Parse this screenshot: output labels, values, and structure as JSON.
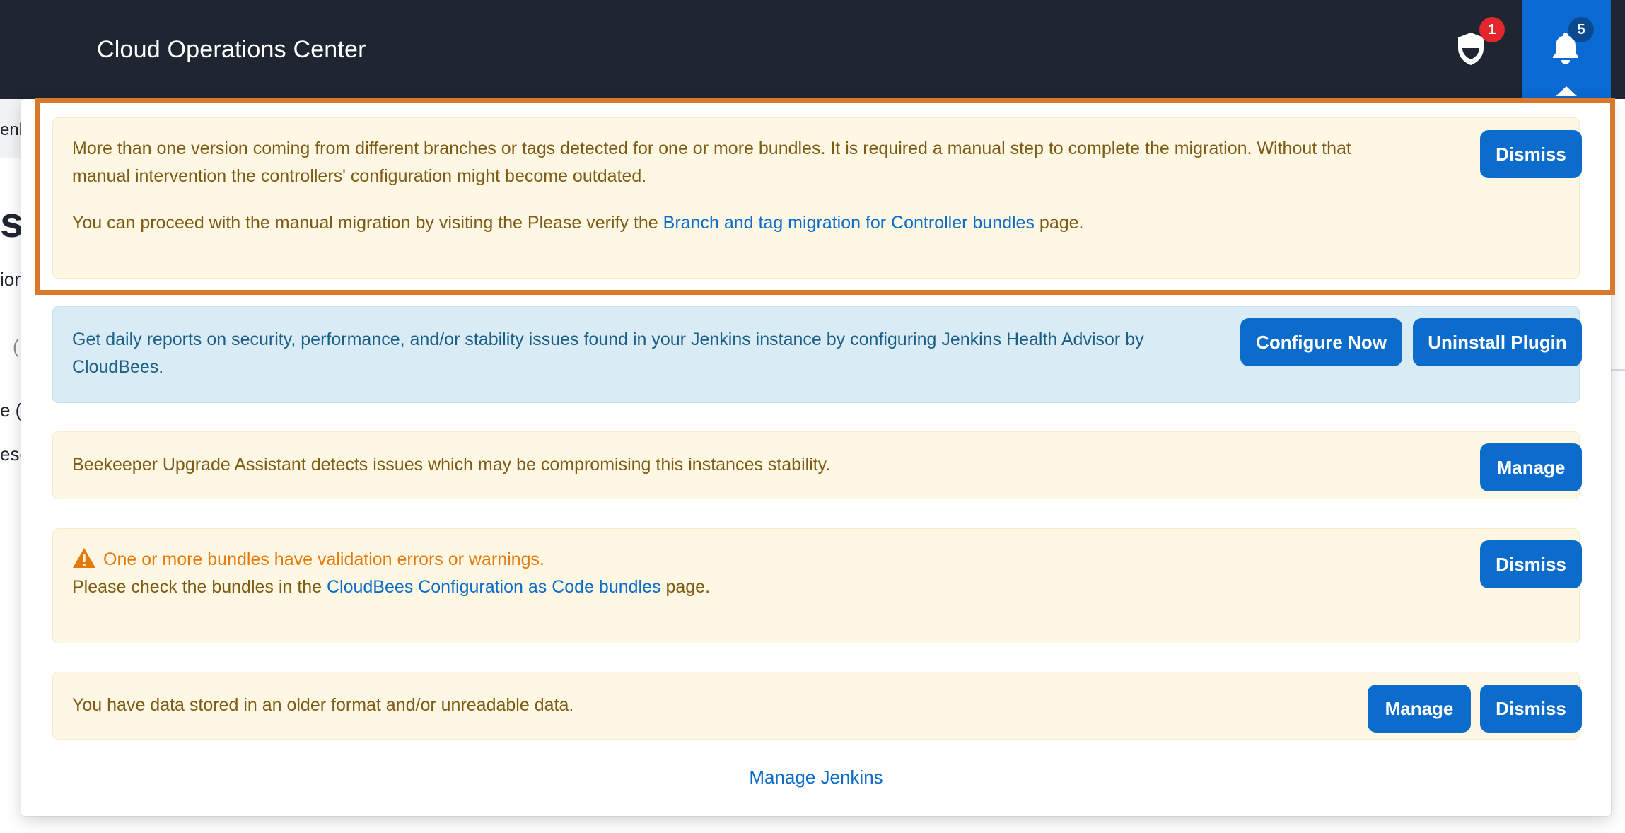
{
  "header": {
    "title": "Cloud Operations Center",
    "security_badge": "1",
    "notifications_badge": "5"
  },
  "background_fragments": {
    "breadcrumb": "enk",
    "heading": "s",
    "line1": "ion",
    "line2": "(",
    "line3": "e (C",
    "line4": "esc"
  },
  "alerts": {
    "migration": {
      "line1": "More than one version coming from different branches or tags detected for one or more bundles. It is required a manual step to complete the migration. Without that",
      "line2": "manual intervention the controllers' configuration might become outdated.",
      "line3_prefix": "You can proceed with the manual migration by visiting the Please verify the ",
      "line3_link": "Branch and tag migration for Controller bundles",
      "line3_suffix": " page.",
      "dismiss": "Dismiss"
    },
    "health_advisor": {
      "line1": "Get daily reports on security, performance, and/or stability issues found in your Jenkins instance by configuring Jenkins Health Advisor by",
      "line2": "CloudBees.",
      "configure": "Configure Now",
      "uninstall": "Uninstall Plugin"
    },
    "beekeeper": {
      "text": "Beekeeper Upgrade Assistant detects issues which may be compromising this instances stability.",
      "manage": "Manage"
    },
    "bundles": {
      "title": "One or more bundles have validation errors or warnings.",
      "line2_prefix": "Please check the bundles in the ",
      "line2_link": "CloudBees Configuration as Code bundles",
      "line2_suffix": " page.",
      "dismiss": "Dismiss"
    },
    "old_data": {
      "text": "You have data stored in an older format and/or unreadable data.",
      "manage": "Manage",
      "dismiss": "Dismiss"
    }
  },
  "footer": {
    "manage_jenkins": "Manage Jenkins"
  },
  "colors": {
    "header_bg": "#1f2631",
    "accent": "#0b6ccc",
    "warning_bg": "#fdf7e3",
    "info_bg": "#d9ecf6",
    "warning_title": "#e57a0a",
    "highlight": "#d9782b"
  }
}
